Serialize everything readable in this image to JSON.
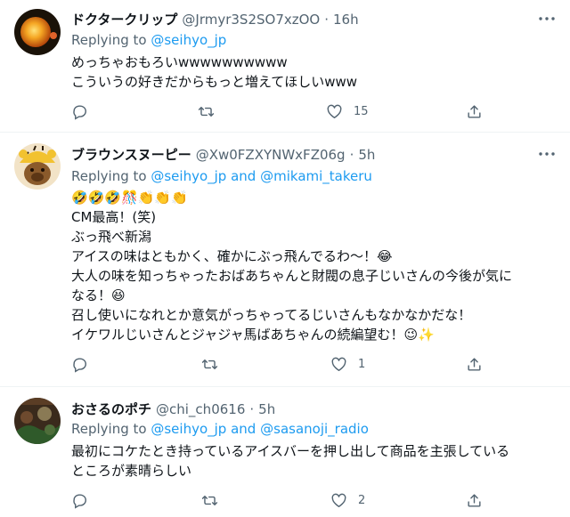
{
  "tweets": [
    {
      "display_name": "ドクタークリップ",
      "handle": "@Jrmyr3S2SO7xzOO",
      "time": "16h",
      "replying_prefix": "Replying to",
      "mentions": [
        "@seihyo_jp"
      ],
      "mention_joiner": "",
      "body_lines": [
        "めっちゃおもろいwwwwwwwwww",
        "こういうの好きだからもっと増えてほしいwww"
      ],
      "reply_count": "",
      "retweet_count": "",
      "like_count": "15"
    },
    {
      "display_name": "ブラウンスヌーピー",
      "handle": "@Xw0FZXYNWxFZ06g",
      "time": "5h",
      "replying_prefix": "Replying to",
      "mentions": [
        "@seihyo_jp",
        "@mikami_takeru"
      ],
      "mention_joiner": "and",
      "body_lines": [
        "🤣🤣🤣🎊👏👏👏",
        "CM最高！(笑)",
        "ぶっ飛べ新潟",
        "アイスの味はともかく、確かにぶっ飛んでるわ〜！😂",
        "大人の味を知っちゃったおばあちゃんと財閥の息子じいさんの今後が気に",
        "なる！😆",
        "召し使いになれとか意気がっちゃってるじいさんもなかなかだな！",
        "イケワルじいさんとジャジャ馬ばあちゃんの続編望む！😉✨"
      ],
      "reply_count": "",
      "retweet_count": "",
      "like_count": "1"
    },
    {
      "display_name": "おさるのポチ",
      "handle": "@chi_ch0616",
      "time": "5h",
      "replying_prefix": "Replying to",
      "mentions": [
        "@seihyo_jp",
        "@sasanoji_radio"
      ],
      "mention_joiner": "and",
      "body_lines": [
        "最初にコケたとき持っているアイスバーを押し出して商品を主張している",
        "ところが素晴らしい"
      ],
      "reply_count": "",
      "retweet_count": "",
      "like_count": "2"
    }
  ],
  "icons": {
    "reply": "reply-icon",
    "retweet": "retweet-icon",
    "like": "heart-icon",
    "share": "share-icon",
    "more": "more-icon"
  },
  "colors": {
    "text": "#0f1419",
    "muted": "#536471",
    "link": "#1d9bf0",
    "divider": "#eff3f4"
  }
}
